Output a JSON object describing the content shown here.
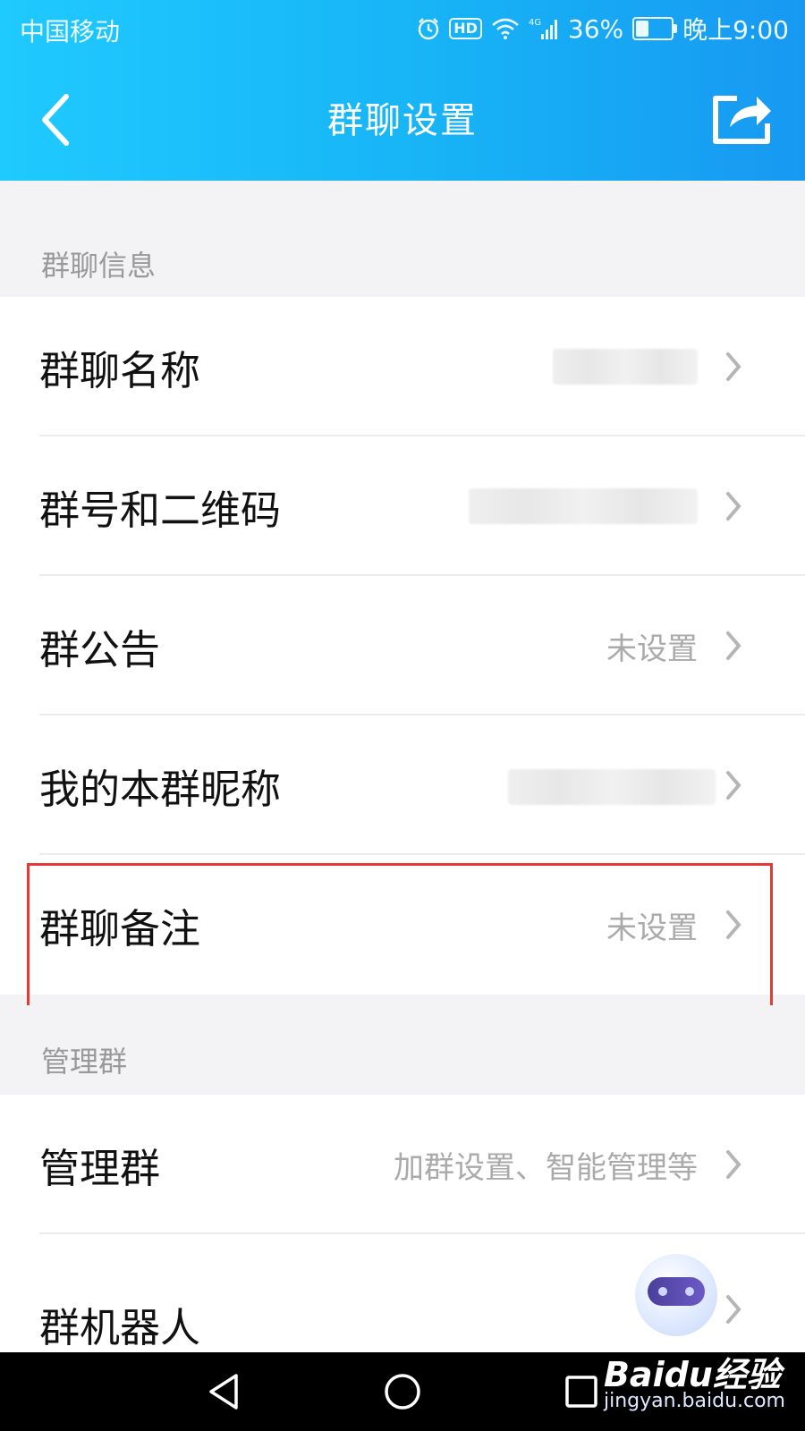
{
  "status_bar": {
    "carrier": "中国移动",
    "network": "4G",
    "battery": "36%",
    "battery_level_percent": 36,
    "time": "晚上9:00",
    "icons": [
      "alarm-icon",
      "hd-icon",
      "wifi-icon",
      "signal-icon",
      "battery-icon"
    ]
  },
  "header": {
    "title": "群聊设置",
    "back_icon": "chevron-left-icon",
    "share_icon": "share-icon",
    "background_color": "#17b3f6"
  },
  "sections": [
    {
      "title": "群聊信息",
      "rows": [
        {
          "label": "群聊名称",
          "value": ""
        },
        {
          "label": "群号和二维码",
          "value": ""
        },
        {
          "label": "群公告",
          "value": "未设置"
        },
        {
          "label": "我的本群昵称",
          "value": ""
        },
        {
          "label": "群聊备注",
          "value": "未设置"
        }
      ]
    },
    {
      "title": "管理群",
      "rows": [
        {
          "label": "管理群",
          "value": "加群设置、智能管理等"
        },
        {
          "label": "群机器人",
          "value": ""
        }
      ]
    }
  ],
  "highlight_color": "#e63a34",
  "navigation_bar": {
    "buttons": [
      "back-triangle-icon",
      "home-circle-icon",
      "recents-square-icon"
    ]
  },
  "watermark": {
    "logo": "Baidu经验",
    "url": "jingyan.baidu.com"
  }
}
